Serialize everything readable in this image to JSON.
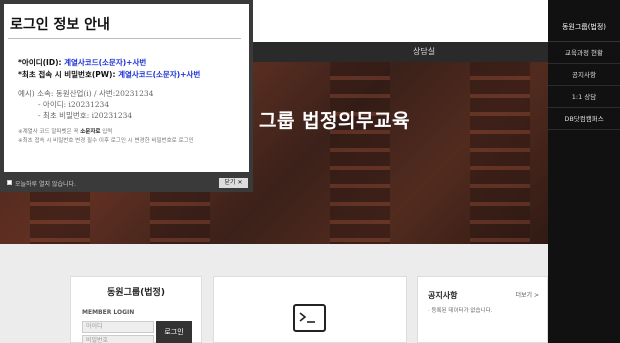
{
  "nav": {
    "counsel": "상담실"
  },
  "hero": {
    "title": "그룹 법정의무교육"
  },
  "sidebar": {
    "header": "동원그룹(법정)",
    "items": [
      {
        "label": "교육과정 현황"
      },
      {
        "label": "공지사항"
      },
      {
        "label": "1:1 상담"
      },
      {
        "label": "DB닷컴캠퍼스"
      }
    ],
    "next_arrow": "›"
  },
  "login_card": {
    "title": "동원그룹(법정)",
    "member_login": "MEMBER LOGIN",
    "id_placeholder": "아이디",
    "pw_placeholder": "비밀번호",
    "login_button": "로그인"
  },
  "notice_card": {
    "title": "공지사항",
    "more": "더보기 >",
    "empty": "· 등록된 데이터가 없습니다."
  },
  "popup": {
    "title": "로그인 정보 안내",
    "id_prefix": "*아이디(ID): ",
    "id_value": "계열사코드(소문자)+사번",
    "pw_prefix": "*최초 접속 시 비밀번호(PW): ",
    "pw_value": "계열사코드(소문자)+사번",
    "example_header": "예시) 소속: 동원산업(i) / 사번:20231234",
    "example_id": "- 아이디: i20231234",
    "example_pw": "- 최초 비밀번호: i20231234",
    "note1_prefix": "※계열사 코드 알파벳은 꼭 ",
    "note1_bold": "소문자로",
    "note1_suffix": " 입력",
    "note2": "※최초 접속 시 비밀번호 변경 필수 이후 로그인 시 변경한 비밀번호로 로그인",
    "dont_show": "오늘하루 열지 않습니다.",
    "close": "닫기 ✕"
  },
  "colors": {
    "highlight": "#1a2fd6",
    "sidebar": "#111111",
    "nav": "#2a2a2a"
  }
}
